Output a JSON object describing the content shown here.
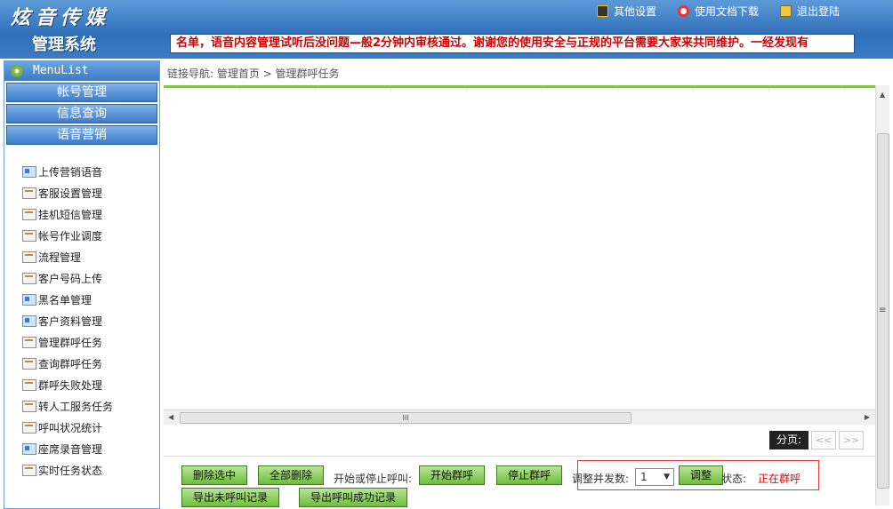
{
  "header": {
    "logo": "炫音传媒",
    "title": "管理系统",
    "links": [
      {
        "icon": "settings-icon",
        "label": "其他设置"
      },
      {
        "icon": "document-icon",
        "label": "使用文档下载"
      },
      {
        "icon": "lock-icon",
        "label": "退出登陆"
      }
    ],
    "notice": "名单，语音内容管理试听后没问题—般2分钟内审核通过。谢谢您的使用安全与正规的平台需要大家来共同维护。一经发现有"
  },
  "sidebar": {
    "head": "MenuList",
    "categories": [
      "帐号管理",
      "信息查询",
      "语音营销"
    ],
    "items": [
      {
        "label": "上传营销语音",
        "icon": "blue"
      },
      {
        "label": "客服设置管理",
        "icon": "note"
      },
      {
        "label": "挂机短信管理",
        "icon": "note"
      },
      {
        "label": "帐号作业调度",
        "icon": "note"
      },
      {
        "label": "流程管理",
        "icon": "note"
      },
      {
        "label": "客户号码上传",
        "icon": "note"
      },
      {
        "label": "黑名单管理",
        "icon": "blue"
      },
      {
        "label": "客户资料管理",
        "icon": "blue"
      },
      {
        "label": "管理群呼任务",
        "icon": "note"
      },
      {
        "label": "查询群呼任务",
        "icon": "note"
      },
      {
        "label": "群呼失败处理",
        "icon": "note"
      },
      {
        "label": "转人工服务任务",
        "icon": "note"
      },
      {
        "label": "呼叫状况统计",
        "icon": "note"
      },
      {
        "label": "座席录音管理",
        "icon": "blue"
      },
      {
        "label": "实时任务状态",
        "icon": "note"
      }
    ]
  },
  "breadcrumb": "链接导航: 管理首页 > 管理群呼任务",
  "pager": {
    "label": "分页:",
    "prev": "<<",
    "next": ">>"
  },
  "toolbar": {
    "delete_selected": "删除选中",
    "delete_all": "全部删除",
    "start_stop_label": "开始或停止呼叫:",
    "start": "开始群呼",
    "stop": "停止群呼",
    "concurrency_label": "调整并发数:",
    "concurrency_value": "1",
    "adjust": "调整",
    "status_label": "状态:",
    "status_value": "正在群呼",
    "export_uncalled": "导出未呼叫记录",
    "export_success": "导出呼叫成功记录"
  },
  "colors": {
    "header": "#2f6fb8",
    "button": "#6cbf3a",
    "status": "#e00000"
  }
}
